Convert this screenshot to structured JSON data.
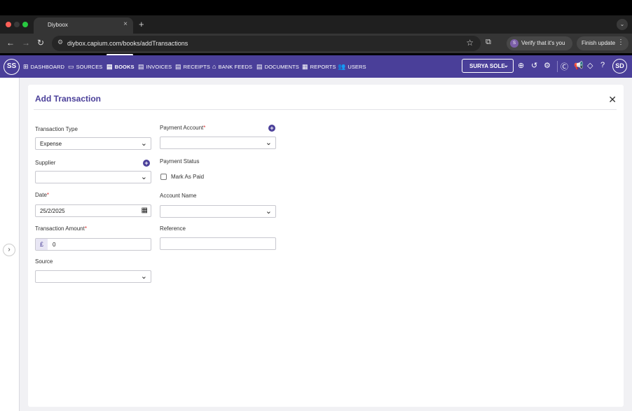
{
  "browser": {
    "tab_title": "Diyboox",
    "tab_close": "×",
    "new_tab": "+",
    "url": "diybox.capium.com/books/addTransactions",
    "verify_avatar": "S",
    "verify_text": "Verify that it's you",
    "finish_update": "Finish update"
  },
  "appnav": {
    "logo": "SS",
    "items": [
      {
        "label": "DASHBOARD",
        "icon": "dashboard-icon"
      },
      {
        "label": "SOURCES",
        "icon": "folder-icon"
      },
      {
        "label": "BOOKS",
        "icon": "books-icon"
      },
      {
        "label": "INVOICES",
        "icon": "invoice-icon"
      },
      {
        "label": "RECEIPTS",
        "icon": "receipt-icon"
      },
      {
        "label": "BANK FEEDS",
        "icon": "bank-icon"
      },
      {
        "label": "DOCUMENTS",
        "icon": "document-icon"
      },
      {
        "label": "REPORTS",
        "icon": "reports-icon"
      },
      {
        "label": "USERS",
        "icon": "users-icon"
      }
    ],
    "company": "SURYA SOLE",
    "user_initials": "SD"
  },
  "form": {
    "title": "Add Transaction",
    "transaction_type": {
      "label": "Transaction Type",
      "value": "Expense"
    },
    "supplier": {
      "label": "Supplier",
      "value": ""
    },
    "date": {
      "label": "Date",
      "value": "25/2/2025"
    },
    "transaction_amount": {
      "label": "Transaction Amount",
      "currency": "£",
      "value": "0"
    },
    "source": {
      "label": "Source",
      "value": ""
    },
    "payment_account": {
      "label": "Payment Account",
      "value": ""
    },
    "payment_status": {
      "label": "Payment Status",
      "checkbox_label": "Mark As Paid",
      "checked": false
    },
    "account_name": {
      "label": "Account Name",
      "value": ""
    },
    "reference": {
      "label": "Reference",
      "value": ""
    }
  },
  "colors": {
    "brand": "#4a3f99",
    "required": "#d33333"
  }
}
